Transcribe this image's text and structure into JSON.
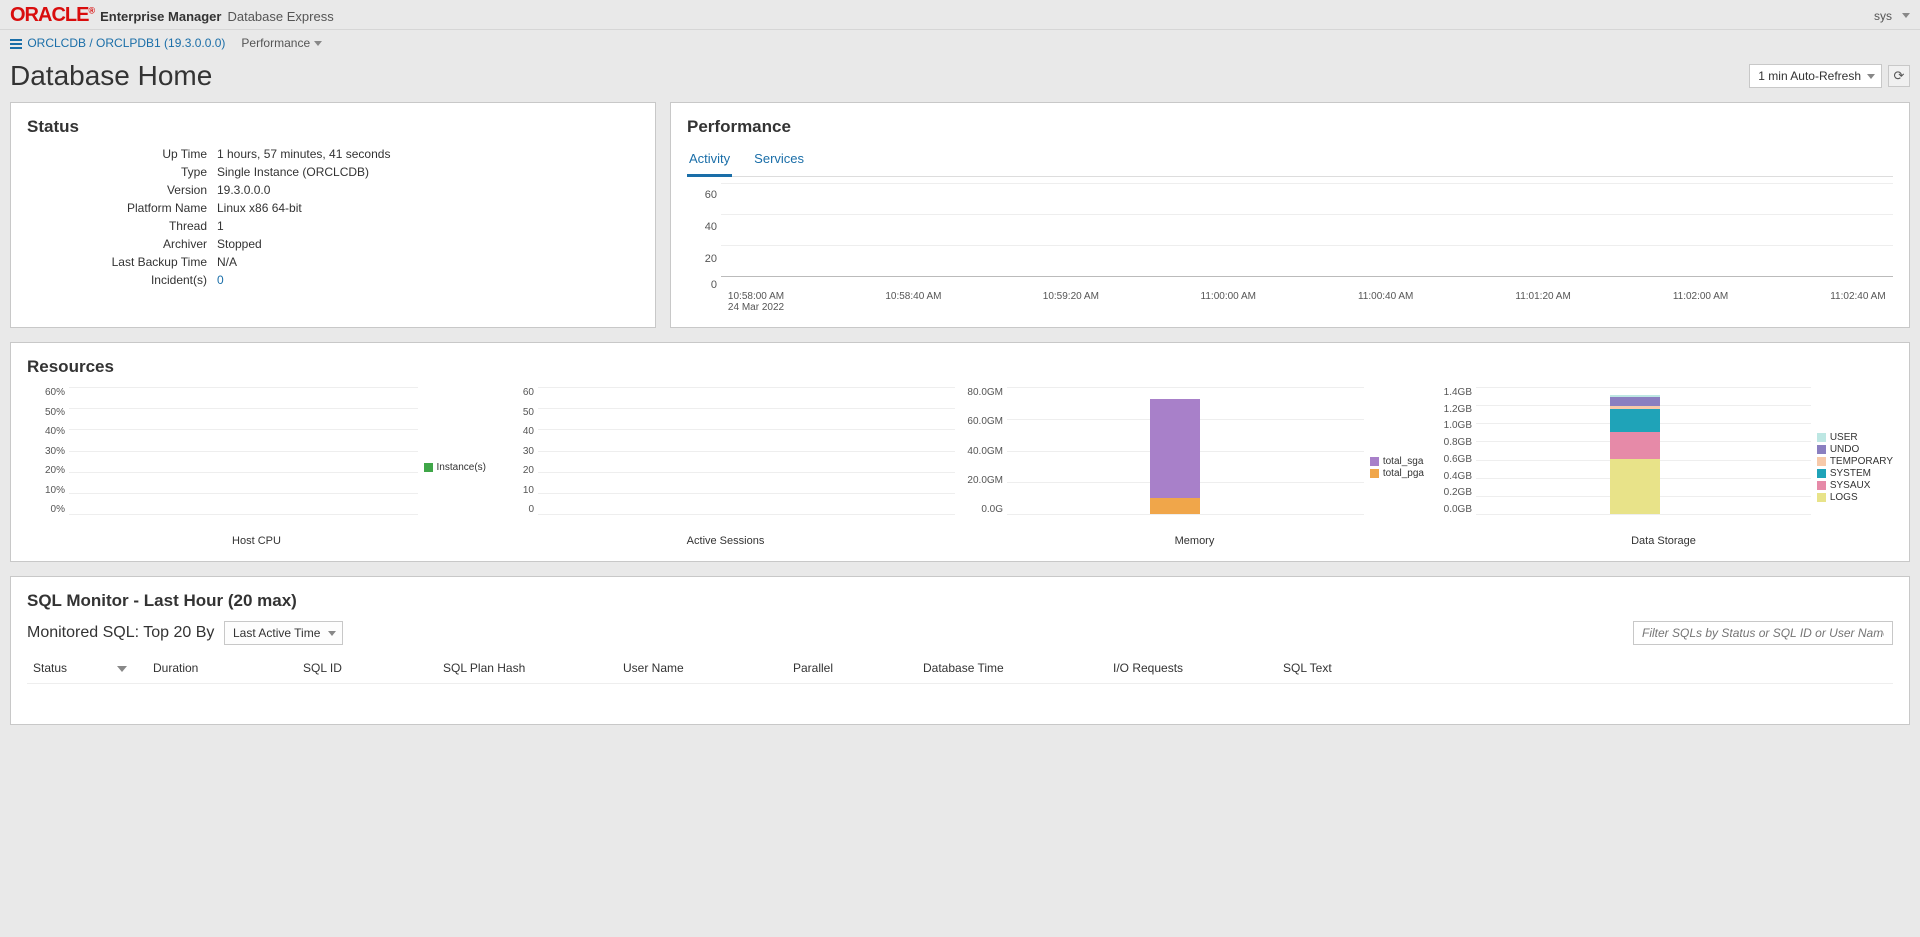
{
  "header": {
    "logo": "ORACLE",
    "em": "Enterprise Manager",
    "de": "Database Express",
    "user": "sys"
  },
  "breadcrumb": {
    "path": "ORCLCDB / ORCLPDB1 (19.3.0.0.0)",
    "menu": "Performance"
  },
  "page": {
    "title": "Database Home",
    "refresh_option": "1 min Auto-Refresh"
  },
  "status": {
    "title": "Status",
    "rows": [
      {
        "label": "Up Time",
        "value": "1 hours, 57 minutes, 41 seconds"
      },
      {
        "label": "Type",
        "value": "Single Instance (ORCLCDB)"
      },
      {
        "label": "Version",
        "value": "19.3.0.0.0"
      },
      {
        "label": "Platform Name",
        "value": "Linux x86 64-bit"
      },
      {
        "label": "Thread",
        "value": "1"
      },
      {
        "label": "Archiver",
        "value": "Stopped"
      },
      {
        "label": "Last Backup Time",
        "value": "N/A"
      },
      {
        "label": "Incident(s)",
        "value": "0",
        "link": true
      }
    ]
  },
  "performance": {
    "title": "Performance",
    "tabs": [
      "Activity",
      "Services"
    ],
    "active_tab": "Activity"
  },
  "resources": {
    "title": "Resources"
  },
  "sqlmon": {
    "title": "SQL Monitor - Last Hour (20 max)",
    "sub_label": "Monitored SQL: Top 20 By",
    "sort_value": "Last Active Time",
    "filter_placeholder": "Filter SQLs by Status or SQL ID or User Name",
    "columns": [
      "Status",
      "Duration",
      "SQL ID",
      "SQL Plan Hash",
      "User Name",
      "Parallel",
      "Database Time",
      "I/O Requests",
      "SQL Text"
    ]
  },
  "chart_data": [
    {
      "type": "line",
      "name": "activity",
      "title": "",
      "y_ticks": [
        "60",
        "40",
        "20",
        "0"
      ],
      "x_ticks": [
        "10:58:00 AM",
        "10:58:40 AM",
        "10:59:20 AM",
        "11:00:00 AM",
        "11:00:40 AM",
        "11:01:20 AM",
        "11:02:00 AM",
        "11:02:40 AM"
      ],
      "x_sub": "24 Mar 2022",
      "series": [],
      "ylim": [
        0,
        60
      ]
    },
    {
      "type": "bar",
      "name": "host_cpu",
      "title": "Host CPU",
      "y_ticks": [
        "60%",
        "50%",
        "40%",
        "30%",
        "20%",
        "10%",
        "0%"
      ],
      "legend": [
        {
          "name": "Instance(s)",
          "color": "#3fa648"
        }
      ],
      "categories": [
        ""
      ],
      "values": [
        0
      ],
      "ylim": [
        0,
        60
      ]
    },
    {
      "type": "bar",
      "name": "active_sessions",
      "title": "Active Sessions",
      "y_ticks": [
        "60",
        "50",
        "40",
        "30",
        "20",
        "10",
        "0"
      ],
      "categories": [
        ""
      ],
      "values": [
        0
      ],
      "ylim": [
        0,
        60
      ]
    },
    {
      "type": "bar",
      "name": "memory",
      "title": "Memory",
      "y_ticks": [
        "80.0GM",
        "60.0GM",
        "40.0GM",
        "20.0GM",
        "0.0G"
      ],
      "legend": [
        {
          "name": "total_sga",
          "color": "#a880c9"
        },
        {
          "name": "total_pga",
          "color": "#f0a64a"
        }
      ],
      "categories": [
        ""
      ],
      "series": [
        {
          "name": "total_pga",
          "values": [
            10
          ],
          "color": "#f0a64a"
        },
        {
          "name": "total_sga",
          "values": [
            62
          ],
          "color": "#a880c9"
        }
      ],
      "ylim": [
        0,
        80
      ]
    },
    {
      "type": "bar",
      "name": "data_storage",
      "title": "Data Storage",
      "y_ticks": [
        "1.4GB",
        "1.2GB",
        "1.0GB",
        "0.8GB",
        "0.6GB",
        "0.4GB",
        "0.2GB",
        "0.0GB"
      ],
      "legend": [
        {
          "name": "USER",
          "color": "#bde7e3"
        },
        {
          "name": "UNDO",
          "color": "#8a7fc0"
        },
        {
          "name": "TEMPORARY",
          "color": "#f7c9a9"
        },
        {
          "name": "SYSTEM",
          "color": "#1fa3b8"
        },
        {
          "name": "SYSAUX",
          "color": "#e68aa8"
        },
        {
          "name": "LOGS",
          "color": "#e8e389"
        }
      ],
      "categories": [
        ""
      ],
      "series": [
        {
          "name": "LOGS",
          "values": [
            0.6
          ],
          "color": "#e8e389"
        },
        {
          "name": "SYSAUX",
          "values": [
            0.3
          ],
          "color": "#e68aa8"
        },
        {
          "name": "SYSTEM",
          "values": [
            0.25
          ],
          "color": "#1fa3b8"
        },
        {
          "name": "TEMPORARY",
          "values": [
            0.03
          ],
          "color": "#f7c9a9"
        },
        {
          "name": "UNDO",
          "values": [
            0.1
          ],
          "color": "#8a7fc0"
        },
        {
          "name": "USER",
          "values": [
            0.02
          ],
          "color": "#bde7e3"
        }
      ],
      "ylim": [
        0,
        1.4
      ]
    }
  ]
}
